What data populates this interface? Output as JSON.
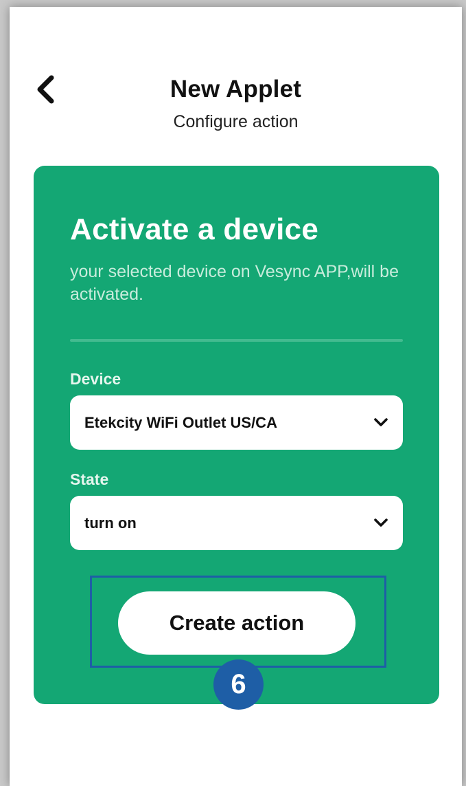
{
  "header": {
    "title": "New Applet",
    "subtitle": "Configure action"
  },
  "card": {
    "title": "Activate a device",
    "description": "your selected device on Vesync APP,will be activated.",
    "background_color": "#14a774",
    "fields": [
      {
        "label": "Device",
        "value": "Etekcity WiFi Outlet US/CA"
      },
      {
        "label": "State",
        "value": "turn on"
      }
    ],
    "create_button_label": "Create action"
  },
  "annotation": {
    "step_number": "6",
    "color": "#1e5ea6"
  },
  "icons": {
    "back": "chevron-left-icon",
    "dropdown": "chevron-down-icon"
  }
}
